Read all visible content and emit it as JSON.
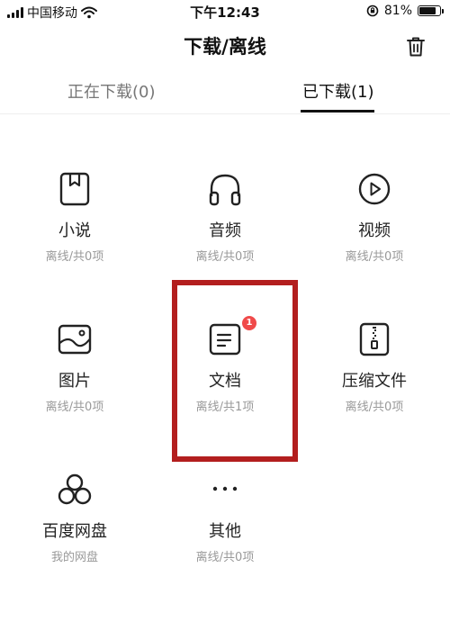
{
  "status_bar": {
    "carrier": "中国移动",
    "time": "下午12:43",
    "battery_percent": "81%",
    "battery_level": 0.81
  },
  "header": {
    "title": "下载/离线",
    "trash_icon": "trash-icon"
  },
  "tabs": [
    {
      "label": "正在下载(0)",
      "active": false
    },
    {
      "label": "已下载(1)",
      "active": true
    }
  ],
  "categories": [
    {
      "label": "小说",
      "sub": "离线/共0项",
      "icon": "book-icon"
    },
    {
      "label": "音频",
      "sub": "离线/共0项",
      "icon": "headphones-icon"
    },
    {
      "label": "视频",
      "sub": "离线/共0项",
      "icon": "play-circle-icon"
    },
    {
      "label": "图片",
      "sub": "离线/共0项",
      "icon": "image-icon"
    },
    {
      "label": "文档",
      "sub": "离线/共1项",
      "icon": "document-icon",
      "badge": "1"
    },
    {
      "label": "压缩文件",
      "sub": "离线/共0项",
      "icon": "zip-file-icon"
    },
    {
      "label": "百度网盘",
      "sub": "我的网盘",
      "icon": "cloud-disk-icon"
    },
    {
      "label": "其他",
      "sub": "离线/共0项",
      "icon": "more-icon"
    }
  ],
  "colors": {
    "highlight": "#b31e1e",
    "badge": "#f04a4a",
    "text_primary": "#222222",
    "text_secondary": "#999999"
  }
}
